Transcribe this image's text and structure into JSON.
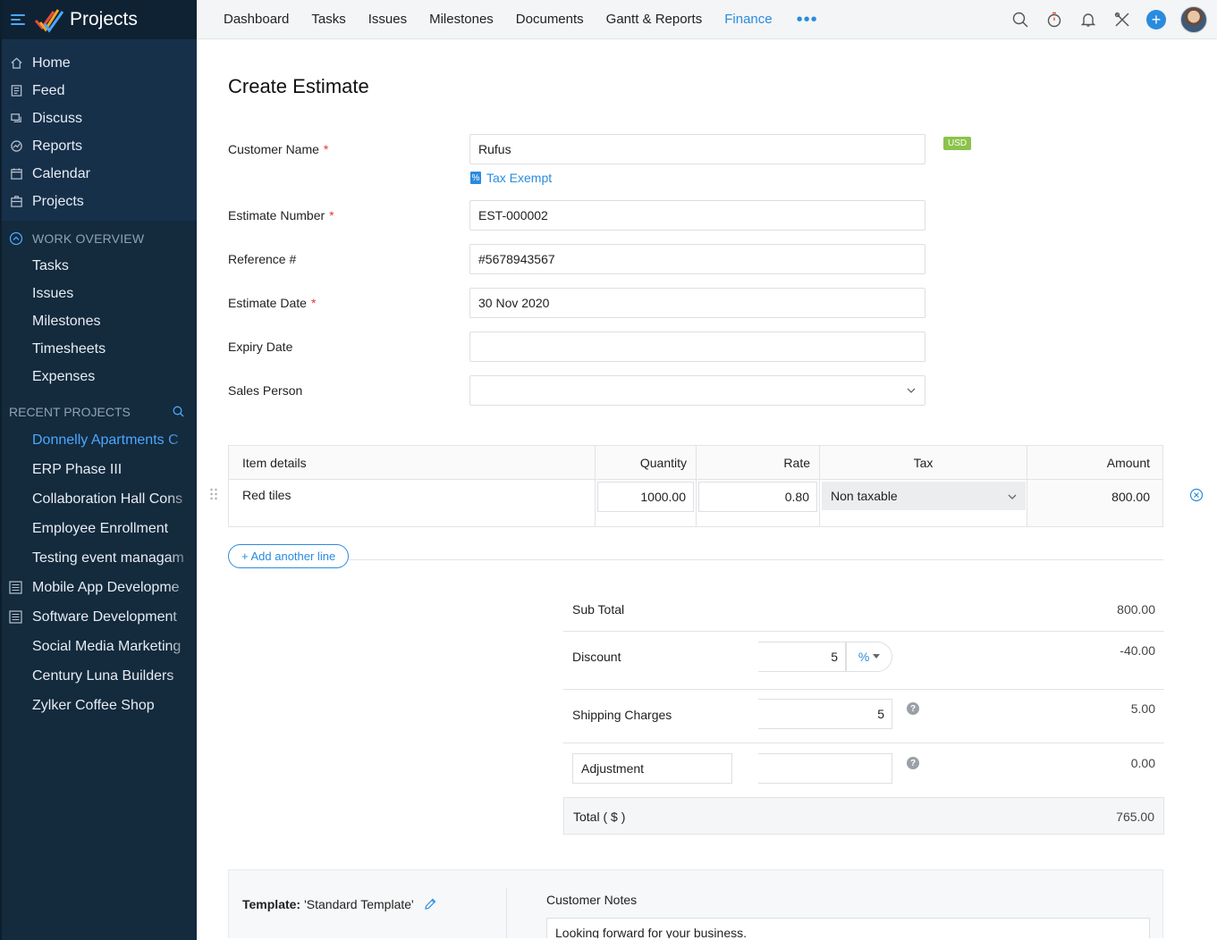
{
  "app": {
    "title": "Projects"
  },
  "sidebar": {
    "nav": [
      {
        "label": "Home",
        "icon": "home-icon"
      },
      {
        "label": "Feed",
        "icon": "feed-icon"
      },
      {
        "label": "Discuss",
        "icon": "discuss-icon"
      },
      {
        "label": "Reports",
        "icon": "reports-icon"
      },
      {
        "label": "Calendar",
        "icon": "calendar-icon"
      },
      {
        "label": "Projects",
        "icon": "projects-icon"
      }
    ],
    "work_overview": {
      "title": "WORK OVERVIEW",
      "items": [
        "Tasks",
        "Issues",
        "Milestones",
        "Timesheets",
        "Expenses"
      ]
    },
    "recent_projects": {
      "title": "RECENT PROJECTS",
      "items": [
        {
          "label": "Donnelly Apartments C",
          "active": true
        },
        {
          "label": "ERP Phase III"
        },
        {
          "label": "Collaboration Hall Cons"
        },
        {
          "label": "Employee Enrollment"
        },
        {
          "label": "Testing event managam"
        },
        {
          "label": "Mobile App Developme",
          "icon": "template-project-icon"
        },
        {
          "label": "Software Development",
          "icon": "template-project-icon"
        },
        {
          "label": "Social Media Marketing"
        },
        {
          "label": "Century Luna Builders"
        },
        {
          "label": "Zylker Coffee Shop"
        }
      ]
    }
  },
  "topnav": {
    "tabs": [
      "Dashboard",
      "Tasks",
      "Issues",
      "Milestones",
      "Documents",
      "Gantt & Reports",
      "Finance"
    ],
    "active_tab": "Finance",
    "more": "•••",
    "plus": "+"
  },
  "form": {
    "title": "Create Estimate",
    "customer_name": {
      "label": "Customer Name",
      "required": "*",
      "value": "Rufus"
    },
    "currency_badge": "USD",
    "tax_exempt": {
      "icon": "%",
      "label": "Tax Exempt"
    },
    "estimate_number": {
      "label": "Estimate Number",
      "required": "*",
      "value": "EST-000002"
    },
    "reference": {
      "label": "Reference #",
      "value": "#5678943567"
    },
    "estimate_date": {
      "label": "Estimate Date",
      "required": "*",
      "value": "30 Nov 2020"
    },
    "expiry_date": {
      "label": "Expiry Date",
      "value": ""
    },
    "sales_person": {
      "label": "Sales Person",
      "value": ""
    }
  },
  "items_table": {
    "headers": [
      "Item details",
      "Quantity",
      "Rate",
      "Tax",
      "Amount"
    ],
    "rows": [
      {
        "item": "Red tiles",
        "quantity": "1000.00",
        "rate": "0.80",
        "tax": "Non taxable",
        "amount": "800.00"
      }
    ],
    "add_line": "+ Add another line"
  },
  "totals": {
    "sub_total": {
      "label": "Sub Total",
      "value": "800.00"
    },
    "discount": {
      "label": "Discount",
      "input": "5",
      "unit": "%",
      "value": "-40.00"
    },
    "shipping": {
      "label": "Shipping Charges",
      "input": "5",
      "value": "5.00"
    },
    "adjustment": {
      "label": "Adjustment",
      "input": "",
      "value": "0.00"
    },
    "total": {
      "label": "Total ( $ )",
      "value": "765.00"
    },
    "help": "?"
  },
  "footer": {
    "template_label": "Template:",
    "template_value": "'Standard Template'",
    "customer_notes_label": "Customer Notes",
    "customer_notes_value": "Looking forward for your business."
  },
  "colors": {
    "accent": "#2a8bde",
    "sidebar_bg": "#142a3d",
    "badge": "#8bc34a"
  }
}
